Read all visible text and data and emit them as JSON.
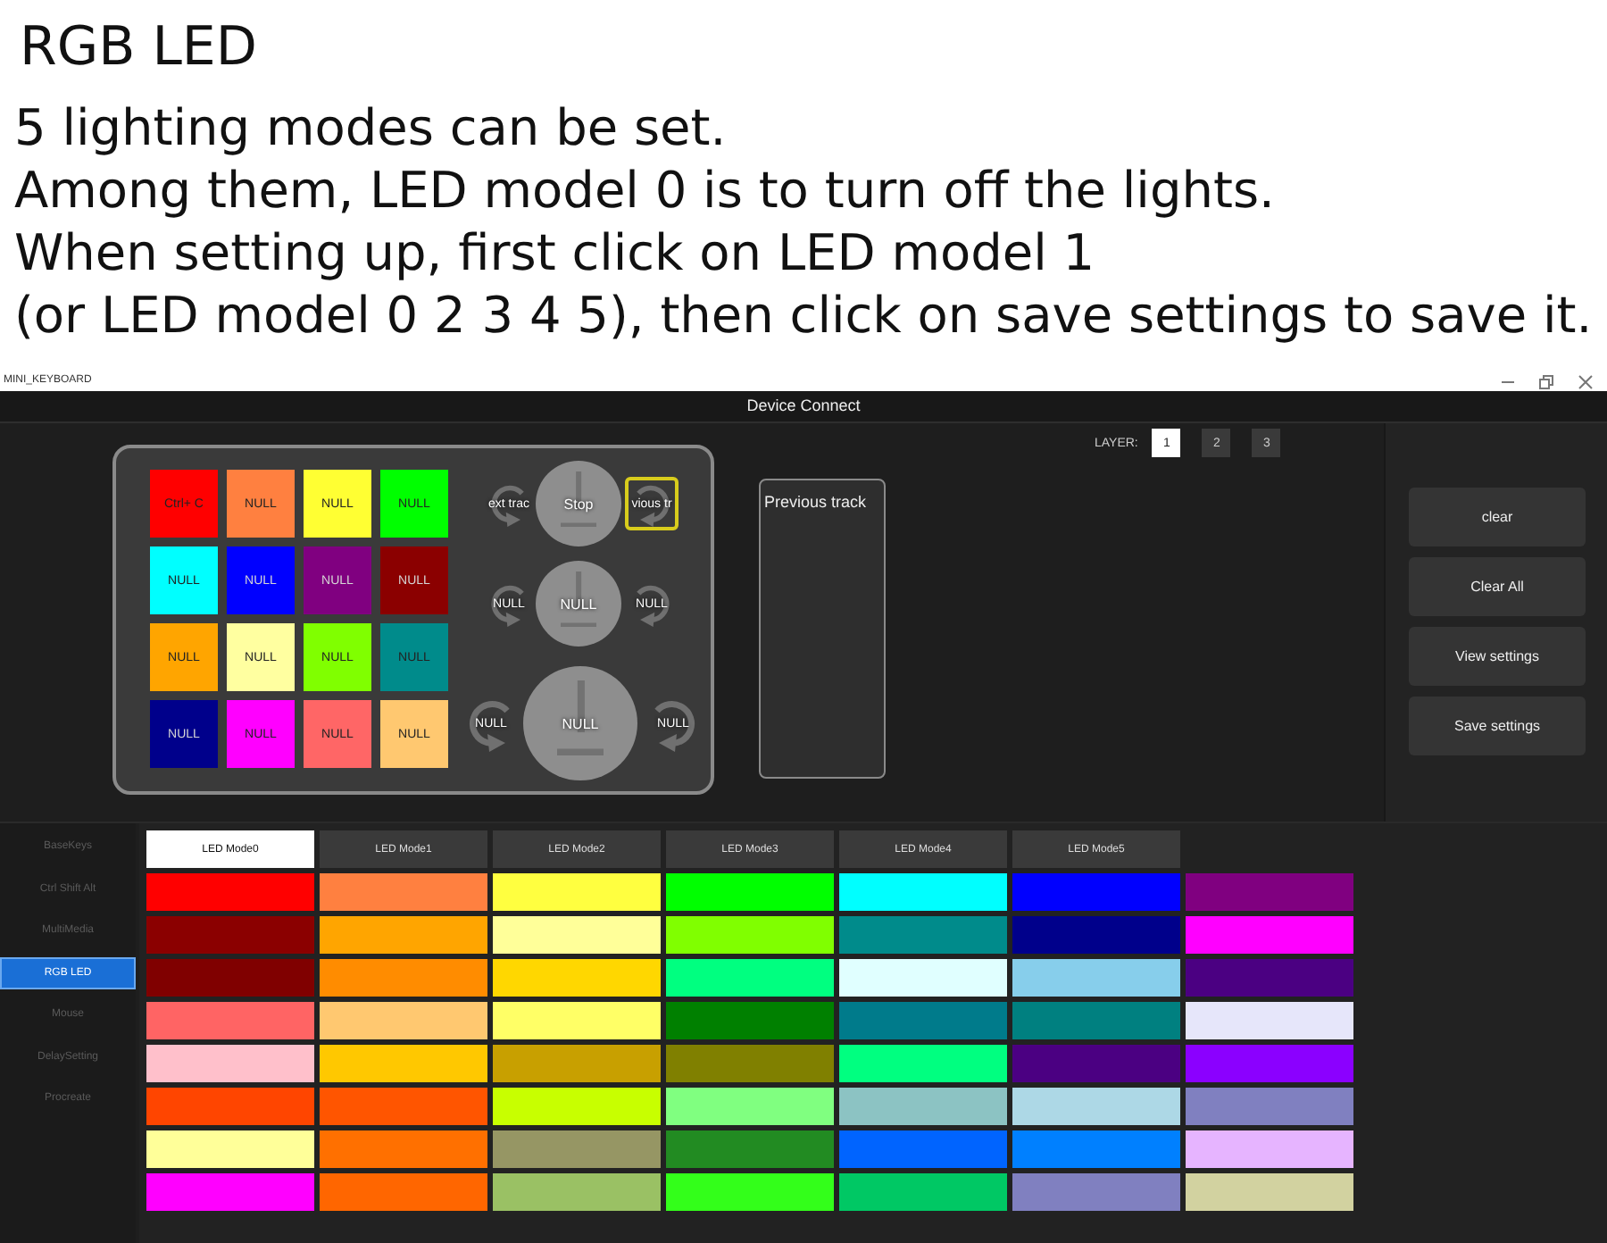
{
  "heading": {
    "title": "RGB LED",
    "lines": [
      "5 lighting modes can be set.",
      "Among them, LED model 0 is to turn off the lights.",
      "When setting up, first click on LED model 1",
      "(or LED model 0 2 3 4 5), then click on save settings to save it."
    ]
  },
  "window": {
    "app_name": "MINI_KEYBOARD",
    "title": "Device Connect"
  },
  "keypad": {
    "keys": [
      {
        "label": "Ctrl+ C",
        "color": "#ff0000"
      },
      {
        "label": "NULL",
        "color": "#ff8040"
      },
      {
        "label": "NULL",
        "color": "#ffff33"
      },
      {
        "label": "NULL",
        "color": "#00ff00"
      },
      {
        "label": "NULL",
        "color": "#00ffff"
      },
      {
        "label": "NULL",
        "color": "#0000ff"
      },
      {
        "label": "NULL",
        "color": "#800080"
      },
      {
        "label": "NULL",
        "color": "#8b0000"
      },
      {
        "label": "NULL",
        "color": "#ffa500"
      },
      {
        "label": "NULL",
        "color": "#ffffa0"
      },
      {
        "label": "NULL",
        "color": "#80ff00"
      },
      {
        "label": "NULL",
        "color": "#008b8b"
      },
      {
        "label": "NULL",
        "color": "#00008b"
      },
      {
        "label": "NULL",
        "color": "#ff00ff"
      },
      {
        "label": "NULL",
        "color": "#ff6666"
      },
      {
        "label": "NULL",
        "color": "#ffc870"
      }
    ],
    "knobs": [
      {
        "kind": "small",
        "label": "Stop",
        "left": {
          "label": "ext trac",
          "selected": false
        },
        "right": {
          "label": "vious tr",
          "selected": true
        }
      },
      {
        "kind": "small",
        "label": "NULL",
        "left": {
          "label": "NULL",
          "selected": false
        },
        "right": {
          "label": "NULL",
          "selected": false
        }
      },
      {
        "kind": "large",
        "label": "NULL",
        "left": {
          "label": "NULL",
          "selected": false
        },
        "right": {
          "label": "NULL",
          "selected": false
        }
      }
    ]
  },
  "preview": {
    "text": "Previous track"
  },
  "layer": {
    "label": "LAYER:",
    "buttons": [
      {
        "label": "1",
        "selected": true
      },
      {
        "label": "2",
        "selected": false
      },
      {
        "label": "3",
        "selected": false
      }
    ]
  },
  "actions": [
    "clear",
    "Clear All",
    "View settings",
    "Save settings"
  ],
  "sidebar": {
    "items": [
      {
        "label": "BaseKeys",
        "selected": false
      },
      {
        "label": "Ctrl Shift Alt",
        "selected": false
      },
      {
        "label": "MultiMedia",
        "selected": false
      },
      {
        "label": "RGB LED",
        "selected": true
      },
      {
        "label": "Mouse",
        "selected": false
      },
      {
        "label": "DelaySetting",
        "selected": false
      },
      {
        "label": "Procreate",
        "selected": false
      }
    ]
  },
  "led_modes": [
    {
      "label": "LED Mode0",
      "selected": true
    },
    {
      "label": "LED Mode1",
      "selected": false
    },
    {
      "label": "LED Mode2",
      "selected": false
    },
    {
      "label": "LED Mode3",
      "selected": false
    },
    {
      "label": "LED Mode4",
      "selected": false
    },
    {
      "label": "LED Mode5",
      "selected": false
    }
  ],
  "palette": [
    [
      {
        "color": "#ff0000"
      },
      {
        "color": "#ff8040"
      },
      {
        "color": "#ffff40"
      },
      {
        "color": "#00ff00"
      },
      {
        "color": "#00ffff"
      },
      {
        "color": "#0000ff"
      },
      {
        "color": "#800080"
      }
    ],
    [
      {
        "color": "#8b0000"
      },
      {
        "color": "#ffa500"
      },
      {
        "color": "#ffff99"
      },
      {
        "color": "#80ff00"
      },
      {
        "color": "#008b8b"
      },
      {
        "color": "#00008b"
      },
      {
        "color": "#ff00ff"
      }
    ],
    [
      {
        "color": "#800000"
      },
      {
        "color": "#ff8c00"
      },
      {
        "color": "#ffd700"
      },
      {
        "color": "#00ff80"
      },
      {
        "color": "#e0ffff"
      },
      {
        "color": "#87ceeb"
      },
      {
        "color": "#4b0082"
      }
    ],
    [
      {
        "color": "#ff6464"
      },
      {
        "color": "#ffc870"
      },
      {
        "color": "#ffff66"
      },
      {
        "color": "#008000"
      },
      {
        "color": "#007b8b"
      },
      {
        "color": "#008080"
      },
      {
        "color": "#e6e6fa"
      }
    ],
    [
      {
        "color": "#ffc0cb"
      },
      {
        "color": "#ffc800"
      },
      {
        "color": "#c8a000"
      },
      {
        "color": "#808000"
      },
      {
        "color": "#00ff80"
      },
      {
        "color": "#4b0082"
      },
      {
        "color": "#8b00ff"
      }
    ],
    [
      {
        "color": "#ff4500"
      },
      {
        "color": "#ff5500"
      },
      {
        "color": "#c8ff00"
      },
      {
        "color": "#80ff80"
      },
      {
        "color": "#8cc3c3"
      },
      {
        "color": "#add8e6"
      },
      {
        "color": "#8080c0"
      }
    ],
    [
      {
        "color": "#ffff99"
      },
      {
        "color": "#ff7000"
      },
      {
        "color": "#969664"
      },
      {
        "color": "#228b22"
      },
      {
        "color": "#0064ff"
      },
      {
        "color": "#0080ff"
      },
      {
        "color": "#e6b4ff"
      }
    ],
    [
      {
        "color": "#ff00ff"
      },
      {
        "color": "#ff6600"
      },
      {
        "color": "#9ac164"
      },
      {
        "color": "#33ff1a"
      },
      {
        "color": "#00c864"
      },
      {
        "color": "#8080c0"
      },
      {
        "color": "#d2d2a0"
      }
    ]
  ]
}
